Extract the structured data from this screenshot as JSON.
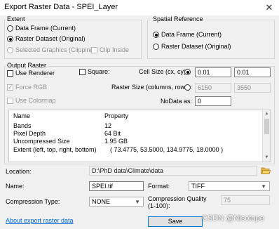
{
  "window": {
    "title": "Export Raster Data - SPEI_Layer",
    "close_glyph": "✕"
  },
  "extent": {
    "title": "Extent",
    "options": [
      "Data Frame (Current)",
      "Raster Dataset (Original)",
      "Selected Graphics (Clipping)"
    ],
    "selected_index": 1,
    "clip_inside": "Clip Inside"
  },
  "spatial_reference": {
    "title": "Spatial Reference",
    "options": [
      "Data Frame (Current)",
      "Raster Dataset (Original)"
    ],
    "selected_index": 0
  },
  "output_raster": {
    "title": "Output Raster",
    "use_renderer": "Use Renderer",
    "force_rgb": "Force RGB",
    "use_colormap": "Use Colormap",
    "square": "Square:",
    "cell_size_label": "Cell Size (cx, cy):",
    "cell_size_x": "0.01",
    "cell_size_y": "0.01",
    "raster_size_label": "Raster Size (columns, rows):",
    "columns": "6150",
    "rows": "3550",
    "nodata_label": "NoData as:",
    "nodata_value": "0"
  },
  "properties": {
    "headers": [
      "Name",
      "Property"
    ],
    "rows": [
      [
        "Bands",
        "12"
      ],
      [
        "Pixel Depth",
        "64 Bit"
      ],
      [
        "Uncompressed Size",
        "1.95 GB"
      ],
      [
        "Extent (left, top, right, bottom)",
        "( 73.4775, 53.5000, 134.9775, 18.0000 )"
      ]
    ]
  },
  "location": {
    "label": "Location:",
    "value": "D:\\PhD data\\Climate\\data"
  },
  "name": {
    "label": "Name:",
    "value": "SPEI.tif"
  },
  "format": {
    "label": "Format:",
    "value": "TIFF"
  },
  "compression_type": {
    "label": "Compression Type:",
    "value": "NONE"
  },
  "compression_quality": {
    "label": "Compression Quality\n(1-100):",
    "value": "75"
  },
  "about_link": "About export raster data",
  "save_button": "Save",
  "watermark": "CSDN @Nisotope"
}
